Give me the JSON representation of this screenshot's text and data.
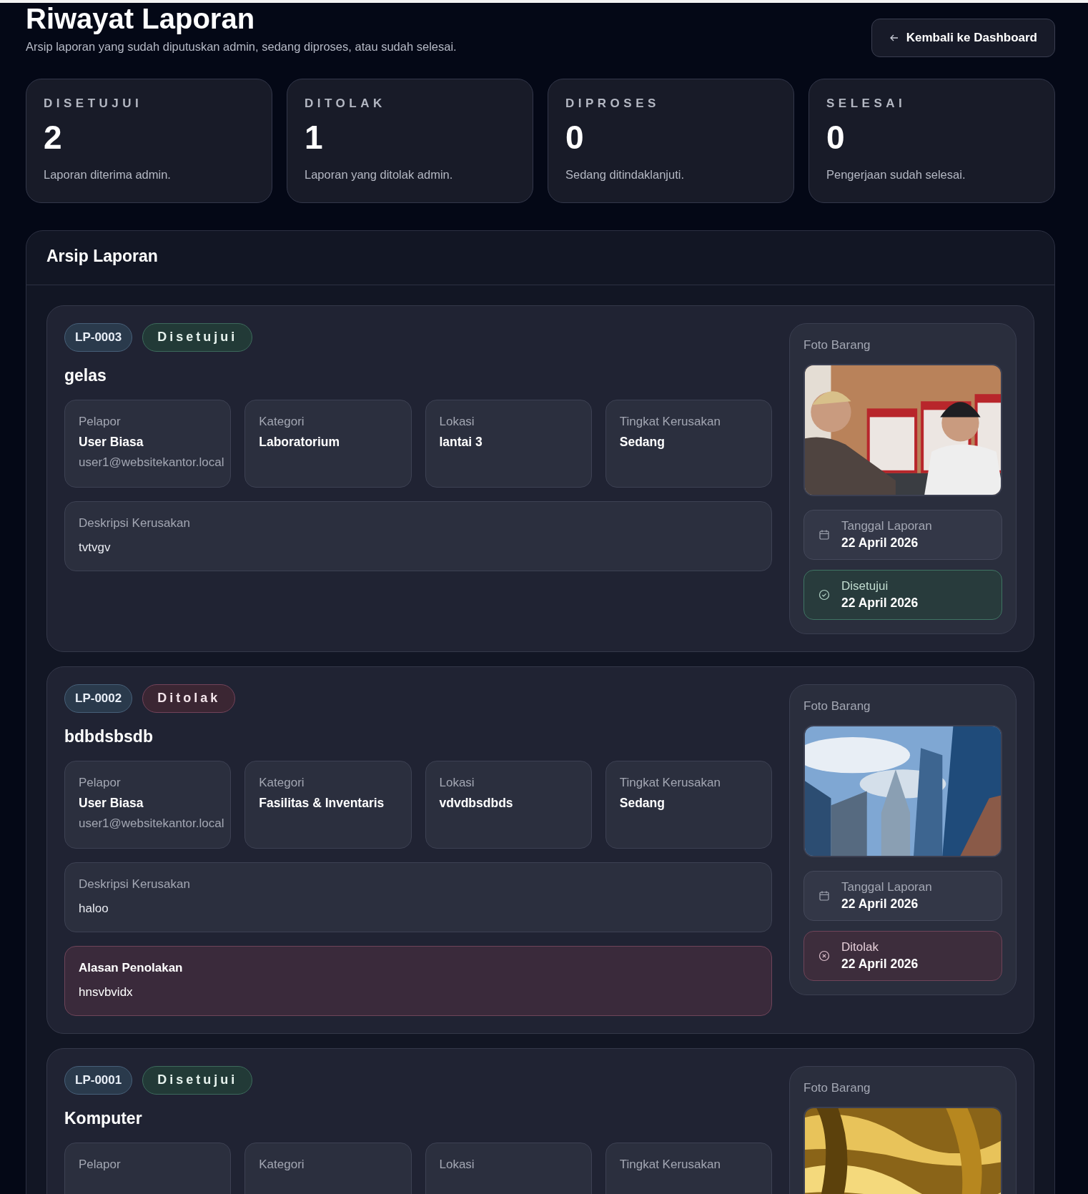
{
  "header": {
    "title": "Riwayat Laporan",
    "subtitle": "Arsip laporan yang sudah diputuskan admin, sedang diproses, atau sudah selesai.",
    "back_button": "Kembali ke Dashboard"
  },
  "stats": [
    {
      "label": "DISETUJUI",
      "value": "2",
      "description": "Laporan diterima admin."
    },
    {
      "label": "DITOLAK",
      "value": "1",
      "description": "Laporan yang ditolak admin."
    },
    {
      "label": "DIPROSES",
      "value": "0",
      "description": "Sedang ditindaklanjuti."
    },
    {
      "label": "SELESAI",
      "value": "0",
      "description": "Pengerjaan sudah selesai."
    }
  ],
  "archive": {
    "title": "Arsip Laporan",
    "reports": [
      {
        "code": "LP-0003",
        "kind": "approved",
        "status_label": "Disetujui",
        "title": "gelas",
        "fields": [
          {
            "label": "Pelapor",
            "value": "User Biasa",
            "sub": "user1@websitekantor.local"
          },
          {
            "label": "Kategori",
            "value": "Laboratorium"
          },
          {
            "label": "Lokasi",
            "value": "lantai 3"
          },
          {
            "label": "Tingkat Kerusakan",
            "value": "Sedang"
          }
        ],
        "description": {
          "label": "Deskripsi Kerusakan",
          "text": "tvtvgv"
        },
        "photo": {
          "label": "Foto Barang",
          "kind": "picture"
        },
        "dates": [
          {
            "kind": "report",
            "label": "Tanggal Laporan",
            "value": "22 April 2026"
          },
          {
            "kind": "decision",
            "label": "Disetujui",
            "value": "22 April 2026"
          }
        ]
      },
      {
        "code": "LP-0002",
        "kind": "rejected",
        "status_label": "Ditolak",
        "title": "bdbdsbsdb",
        "fields": [
          {
            "label": "Pelapor",
            "value": "User Biasa",
            "sub": "user1@websitekantor.local"
          },
          {
            "label": "Kategori",
            "value": "Fasilitas & Inventaris"
          },
          {
            "label": "Lokasi",
            "value": "vdvdbsdbds"
          },
          {
            "label": "Tingkat Kerusakan",
            "value": "Sedang"
          }
        ],
        "description": {
          "label": "Deskripsi Kerusakan",
          "text": "haloo"
        },
        "rejection": {
          "label": "Alasan Penolakan",
          "text": "hnsvbvidx"
        },
        "photo": {
          "label": "Foto Barang",
          "kind": "picture"
        },
        "dates": [
          {
            "kind": "report",
            "label": "Tanggal Laporan",
            "value": "22 April 2026"
          },
          {
            "kind": "decision",
            "label": "Ditolak",
            "value": "22 April 2026"
          }
        ]
      },
      {
        "code": "LP-0001",
        "kind": "approved",
        "status_label": "Disetujui",
        "title": "Komputer",
        "fields": [
          {
            "label": "Pelapor"
          },
          {
            "label": "Kategori"
          },
          {
            "label": "Lokasi"
          },
          {
            "label": "Tingkat Kerusakan"
          }
        ],
        "photo": {
          "label": "Foto Barang",
          "kind": "picture"
        }
      }
    ]
  }
}
